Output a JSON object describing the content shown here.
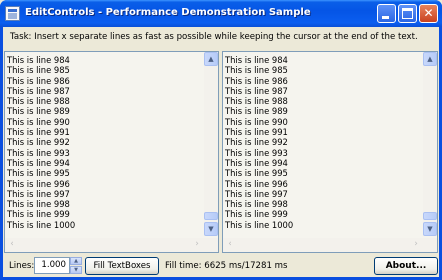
{
  "window": {
    "title": "EditControls - Performance Demonstration Sample"
  },
  "task_text": "Task: Insert x separate lines as fast as possible while keeping the cursor at the end of the text.",
  "left_textbox": {
    "lines": [
      "This is line 984",
      "This is line 985",
      "This is line 986",
      "This is line 987",
      "This is line 988",
      "This is line 989",
      "This is line 990",
      "This is line 991",
      "This is line 992",
      "This is line 993",
      "This is line 994",
      "This is line 995",
      "This is line 996",
      "This is line 997",
      "This is line 998",
      "This is line 999",
      "This is line 1000"
    ]
  },
  "right_textbox": {
    "lines": [
      "This is line 984",
      "This is line 985",
      "This is line 986",
      "This is line 987",
      "This is line 988",
      "This is line 989",
      "This is line 990",
      "This is line 991",
      "This is line 992",
      "This is line 993",
      "This is line 994",
      "This is line 995",
      "This is line 996",
      "This is line 997",
      "This is line 998",
      "This is line 999",
      "This is line 1000"
    ]
  },
  "bottom": {
    "lines_label": "Lines:",
    "lines_value": "1.000",
    "fill_button_label": "Fill TextBoxes",
    "fill_time_text": "Fill time: 6625 ms/17281 ms",
    "about_button_label": "About..."
  },
  "icons": {
    "minimize": "minimize-icon",
    "maximize": "maximize-icon",
    "close": "close-icon",
    "scroll_up": "chevron-up-icon",
    "scroll_down": "chevron-down-icon",
    "scroll_left": "chevron-left-icon",
    "scroll_right": "chevron-right-icon"
  },
  "colors": {
    "titlebar": "#0555e6",
    "window_face": "#ece9d8",
    "textbox_bg": "#f5f4ee"
  }
}
